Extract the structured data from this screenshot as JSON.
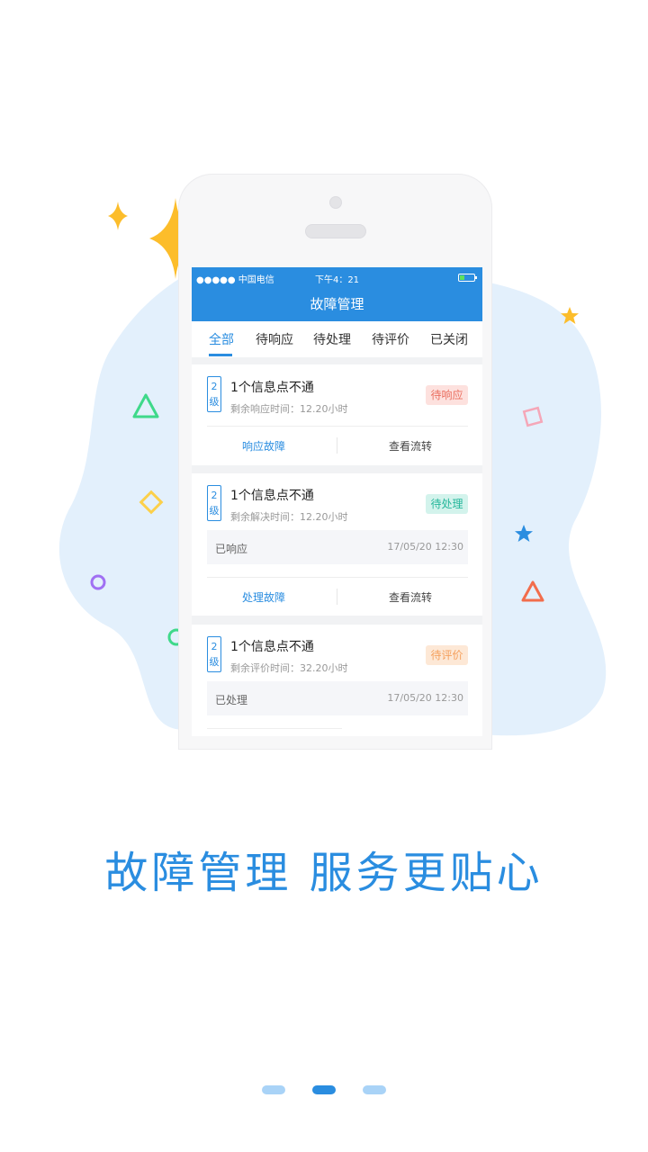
{
  "colors": {
    "accent": "#2a8de0",
    "blob": "#e3f0fc",
    "star": "#fcbd2b"
  },
  "status_bar": {
    "carrier": "●●●●● 中国电信",
    "time": "下午4：21",
    "battery_icon": "battery-icon"
  },
  "header": {
    "title": "故障管理"
  },
  "tabs": [
    {
      "label": "全部",
      "active": true
    },
    {
      "label": "待响应",
      "active": false
    },
    {
      "label": "待处理",
      "active": false
    },
    {
      "label": "待评价",
      "active": false
    },
    {
      "label": "已关闭",
      "active": false
    }
  ],
  "cards": [
    {
      "level_num": "2",
      "level_text": "级",
      "title": "1个信息点不通",
      "subtitle": "剩余响应时间：12.20小时",
      "status": "待响应",
      "action_primary": "响应故障",
      "action_secondary": "查看流转"
    },
    {
      "level_num": "2",
      "level_text": "级",
      "title": "1个信息点不通",
      "subtitle": "剩余解决时间：12.20小时",
      "status": "待处理",
      "history_label": "已响应",
      "history_time": "17/05/20 12:30",
      "action_primary": "处理故障",
      "action_secondary": "查看流转"
    },
    {
      "level_num": "2",
      "level_text": "级",
      "title": "1个信息点不通",
      "subtitle": "剩余评价时间：32.20小时",
      "status": "待评价",
      "history_label": "已处理",
      "history_time": "17/05/20 12:30"
    }
  ],
  "slogan": "故障管理 服务更贴心",
  "pagination": {
    "total": 3,
    "current": 2
  }
}
